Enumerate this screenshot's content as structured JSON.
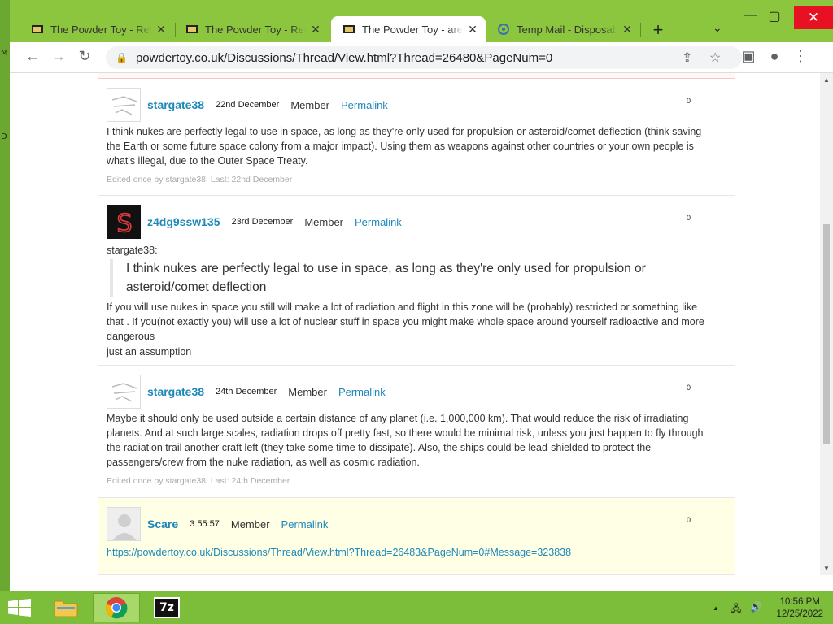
{
  "desktop": {
    "left_glyphs": [
      "M",
      "D"
    ]
  },
  "browser": {
    "tabs": [
      {
        "title": "The Powder Toy - Regis",
        "active": false
      },
      {
        "title": "The Powder Toy - Regis",
        "active": false
      },
      {
        "title": "The Powder Toy - are nu",
        "active": true
      },
      {
        "title": "Temp Mail - Disposable",
        "active": false
      }
    ],
    "new_tab_symbol": "+",
    "tab_search_symbol": "⌄",
    "window_controls": {
      "minimize": "—",
      "maximize": "▢",
      "close": "✕"
    },
    "toolbar": {
      "back": "←",
      "forward": "→",
      "reload": "↻"
    },
    "url": "powdertoy.co.uk/Discussions/Thread/View.html?Thread=26480&PageNum=0",
    "omnibox_icons": {
      "share": "⇪",
      "bookmark": "☆"
    },
    "right_icons": {
      "sidepanel": "▣",
      "profile": "●",
      "menu": "⋮"
    }
  },
  "posts": [
    {
      "user": "stargate38",
      "date": "22nd December",
      "role": "Member",
      "permalink": "Permalink",
      "score": "0",
      "avatar": "sketch",
      "body": "I think nukes are perfectly legal to use in space, as long as they're only used for propulsion or asteroid/comet deflection (think saving the Earth or some future space colony from a major impact). Using them as weapons against other countries or your own people is what's illegal, due to the Outer Space Treaty.",
      "edited": "Edited once by stargate38. Last: 22nd December"
    },
    {
      "user": "z4dg9ssw135",
      "date": "23rd December",
      "role": "Member",
      "permalink": "Permalink",
      "score": "0",
      "avatar": "s-logo",
      "quote_author": "stargate38:",
      "quote": "I think nukes are perfectly legal to use in space, as long as they're only used for propulsion or asteroid/comet deflection",
      "body": " If you will use nukes in space you still will make a lot of radiation and flight in this zone will be (probably) restricted or something like that . If you(not exactly you) will use a lot of nuclear stuff in space you might make whole space around yourself radioactive and more dangerous",
      "body2": "just an assumption"
    },
    {
      "user": "stargate38",
      "date": "24th December",
      "role": "Member",
      "permalink": "Permalink",
      "score": "0",
      "avatar": "sketch",
      "body": "Maybe it should only be used outside a certain distance of any planet (i.e. 1,000,000 km). That would reduce the risk of irradiating planets. And at such large scales, radiation drops off pretty fast, so there would be minimal risk, unless you just happen to fly through the radiation trail another craft left (they take some time to dissipate). Also, the ships could be lead-shielded to protect the passengers/crew from the nuke radiation, as well as cosmic radiation.",
      "edited": "Edited once by stargate38. Last: 24th December"
    },
    {
      "user": "Scare",
      "date": "3:55:57",
      "role": "Member",
      "permalink": "Permalink",
      "score": "0",
      "avatar": "default",
      "link": "https://powdertoy.co.uk/Discussions/Thread/View.html?Thread=26483&PageNum=0#Message=323838"
    }
  ],
  "taskbar": {
    "apps": [
      "file-explorer",
      "chrome",
      "7-zip"
    ],
    "seven_zip_label": "7z",
    "clock_time": "10:56 PM",
    "clock_date": "12/25/2022",
    "tray_icons": {
      "chevron": "▲",
      "network": "🖧",
      "volume": "🔊"
    }
  },
  "colors": {
    "chrome_frame": "#8cc63f",
    "link": "#1e88b8",
    "highlight_post": "#ffffe6",
    "close_red": "#e81123"
  }
}
